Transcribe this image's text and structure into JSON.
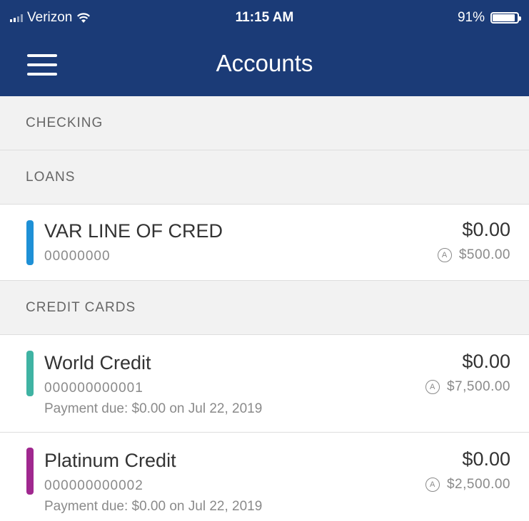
{
  "status_bar": {
    "carrier": "Verizon",
    "time": "11:15 AM",
    "battery": "91%",
    "battery_level": 0.91
  },
  "navbar": {
    "title": "Accounts",
    "menu_icon": "hamburger-menu-icon"
  },
  "sections": {
    "checking": {
      "label": "CHECKING"
    },
    "loans": {
      "label": "LOANS"
    },
    "credit_cards": {
      "label": "CREDIT CARDS"
    }
  },
  "accounts": {
    "var_line": {
      "name": "VAR LINE OF CRED",
      "number": "00000000",
      "balance": "$0.00",
      "available_icon": "A",
      "available": "$500.00",
      "color": "#1e90d6"
    },
    "world_credit": {
      "name": "World Credit",
      "number": "000000000001",
      "payment_due": "Payment due: $0.00 on Jul 22, 2019",
      "balance": "$0.00",
      "available_icon": "A",
      "available": "$7,500.00",
      "color": "#3fb3a3"
    },
    "platinum_credit": {
      "name": "Platinum Credit",
      "number": "000000000002",
      "payment_due": "Payment due: $0.00 on Jul 22, 2019",
      "balance": "$0.00",
      "available_icon": "A",
      "available": "$2,500.00",
      "color": "#a0288f"
    }
  }
}
